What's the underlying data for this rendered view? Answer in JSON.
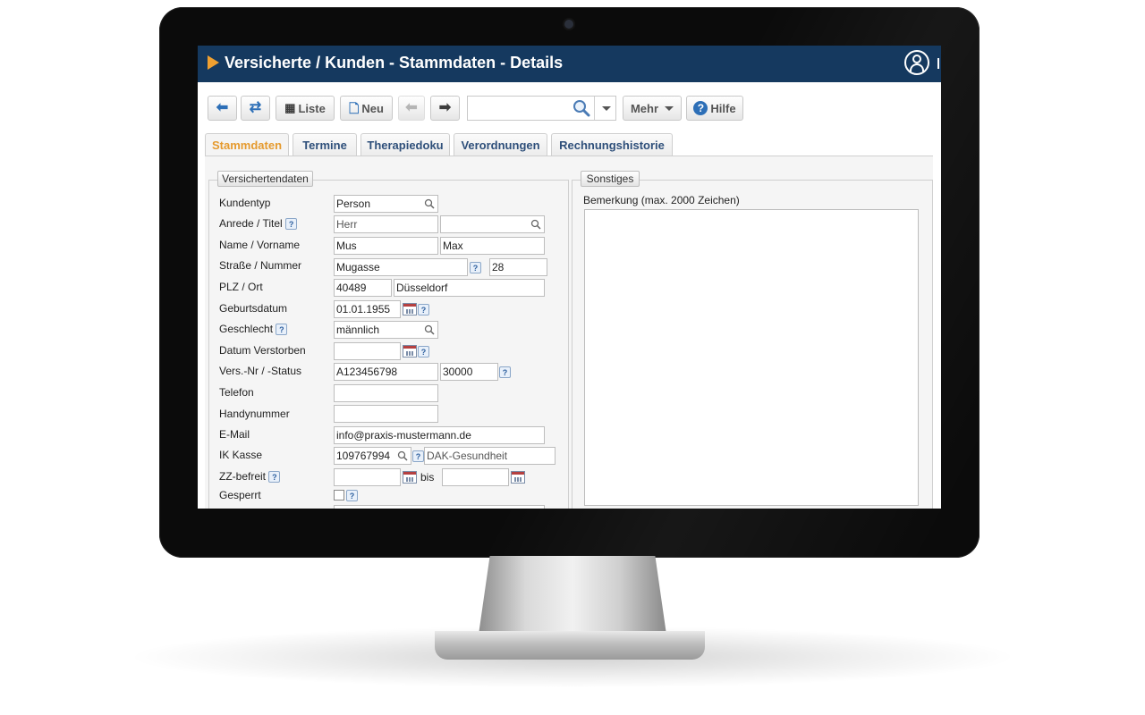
{
  "window": {
    "title": "Versicherte / Kunden - Stammdaten - Details"
  },
  "toolbar": {
    "liste_label": "Liste",
    "neu_label": "Neu",
    "search_value": "",
    "mehr_label": "Mehr",
    "hilfe_label": "Hilfe"
  },
  "tabs": [
    {
      "label": "Stammdaten",
      "active": true
    },
    {
      "label": "Termine"
    },
    {
      "label": "Therapiedoku"
    },
    {
      "label": "Verordnungen"
    },
    {
      "label": "Rechnungshistorie"
    }
  ],
  "versichertendaten": {
    "legend": "Versichertendaten",
    "labels": {
      "kundentyp": "Kundentyp",
      "anrede": "Anrede / Titel",
      "name": "Name / Vorname",
      "strasse": "Straße / Nummer",
      "plz": "PLZ / Ort",
      "geburtsdatum": "Geburtsdatum",
      "geschlecht": "Geschlecht",
      "verstorben": "Datum Verstorben",
      "versnr": "Vers.-Nr / -Status",
      "telefon": "Telefon",
      "handy": "Handynummer",
      "email": "E-Mail",
      "ik": "IK Kasse",
      "zz": "ZZ-befreit",
      "gesperrt": "Gesperrt",
      "bis": "bis"
    },
    "values": {
      "kundentyp": "Person",
      "anrede": "Herr",
      "titel": "",
      "name": "Mus",
      "vorname": "Max",
      "strasse": "Mugasse",
      "nummer": "28",
      "plz": "40489",
      "ort": "Düsseldorf",
      "geburtsdatum": "01.01.1955",
      "geschlecht": "männlich",
      "verstorben": "",
      "versnr": "A123456798",
      "versstatus": "30000",
      "telefon": "",
      "handy": "",
      "email": "info@praxis-mustermann.de",
      "ik": "109767994",
      "kasse": "DAK-Gesundheit",
      "zz_von": "",
      "zz_bis": ""
    },
    "help_glyph": "?"
  },
  "sonstiges": {
    "legend": "Sonstiges",
    "bemerkung_label": "Bemerkung (max. 2000 Zeichen)",
    "bemerkung_value": ""
  },
  "icons": {
    "back": "arrow-left-icon",
    "refresh": "refresh-icon",
    "forward_disabled": "arrow-left-gray-icon",
    "next": "arrow-right-icon"
  },
  "colors": {
    "titlebar": "#15395f",
    "accent": "#f0a030",
    "tab_active": "#e59a2e",
    "link_blue": "#2d6fb7"
  }
}
